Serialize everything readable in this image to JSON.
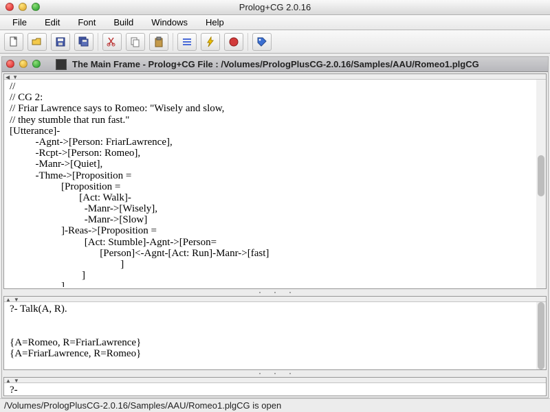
{
  "outer_title": "Prolog+CG 2.0.16",
  "menu": [
    "File",
    "Edit",
    "Font",
    "Build",
    "Windows",
    "Help"
  ],
  "toolbar_icons": {
    "new": "new-file-icon",
    "open": "open-folder-icon",
    "save": "save-icon",
    "saveall": "save-all-icon",
    "cut": "cut-icon",
    "copy": "copy-icon",
    "paste": "paste-icon",
    "list": "list-icon",
    "run": "thunder-icon",
    "stop": "stop-icon",
    "tag": "tag-icon"
  },
  "inner_title": "The Main Frame - Prolog+CG File : /Volumes/PrologPlusCG-2.0.16/Samples/AAU/Romeo1.plgCG",
  "editor_text": "//\n// CG 2:\n// Friar Lawrence says to Romeo: \"Wisely and slow,\n// they stumble that run fast.\"\n[Utterance]-\n          -Agnt->[Person: FriarLawrence],\n          -Rcpt->[Person: Romeo],\n          -Manr->[Quiet],\n          -Thme->[Proposition =\n                    [Proposition =\n                           [Act: Walk]-\n                             -Manr->[Wisely],\n                             -Manr->[Slow]\n                    ]-Reas->[Proposition =\n                             [Act: Stumble]-Agnt->[Person=\n                                   [Person]<-Agnt-[Act: Run]-Manr->[fast]\n                                           ]\n                            ]\n                    ]",
  "console_text": "?- Talk(A, R).\n\n\n{A=Romeo, R=FriarLawrence}\n{A=FriarLawrence, R=Romeo}",
  "prompt_text": "?-",
  "status_text": "/Volumes/PrologPlusCG-2.0.16/Samples/AAU/Romeo1.plgCG is open"
}
